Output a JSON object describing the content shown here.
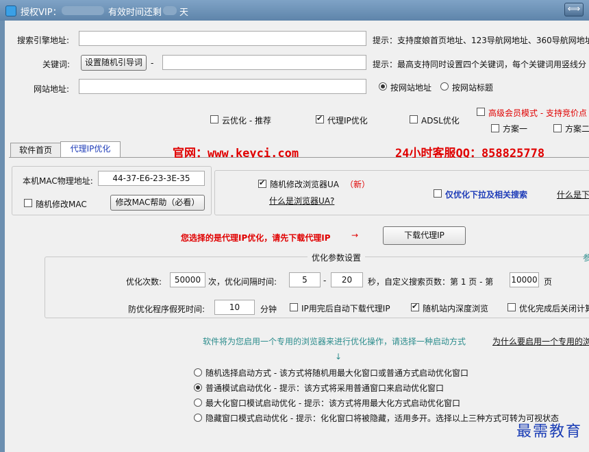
{
  "titlebar": {
    "prefix": "授权VIP：",
    "mid": "有效时间还剩",
    "suffix": "天",
    "restore_icon": "⟺"
  },
  "top": {
    "engine_label": "搜索引擎地址:",
    "engine_value": "",
    "engine_hint": "提示：支持度娘首页地址、123导航网地址、360导航网地址",
    "keyword_label": "关键词:",
    "random_guide_button": "设置随机引导词",
    "dash": "-",
    "keyword_value": "",
    "keyword_hint": "提示：最高支持同时设置四个关键词，每个关键词用竖线分",
    "site_label": "网站地址:",
    "site_value": "",
    "radio_by_url": "按网站地址",
    "radio_by_title": "按网站标题",
    "cloud_opt": "云优化 - 推荐",
    "proxy_opt": "代理IP优化",
    "adsl_opt": "ADSL优化",
    "senior_mode": "高级会员模式 - 支持竞价点",
    "plan1": "方案一",
    "plan2": "方案二"
  },
  "tabs": {
    "home": "软件首页",
    "proxy": "代理IP优化",
    "website": "官网：www.keyci.com",
    "service": "24小时客服QQ：858825778"
  },
  "mac": {
    "label": "本机MAC物理地址:",
    "value": "44-37-E6-23-3E-35",
    "random_mac": "随机修改MAC",
    "help_button": "修改MAC帮助（必看）",
    "random_ua": "随机修改浏览器UA",
    "new_badge": "（新）",
    "what_is_ua": "什么是浏览器UA?",
    "only_dropdown": "仅优化下拉及相关搜索",
    "what_is_dropdown": "什么是下"
  },
  "proxy": {
    "notice": "您选择的是代理IP优化，请先下载代理IP",
    "arrow": "→",
    "download_button": "下载代理IP"
  },
  "params": {
    "group_title": "优化参数设置",
    "more": "参",
    "count_label": "优化次数:",
    "count_value": "50000",
    "times_interval": "次，优化间隔时间:",
    "interval_min": "5",
    "dash": "-",
    "interval_max": "20",
    "seconds_pages": "秒，自定义搜索页数：第 1 页 - 第",
    "page_max": "10000",
    "page_unit": "页",
    "freeze_label": "防优化程序假死时间:",
    "freeze_value": "10",
    "minutes": "分钟",
    "auto_download": "IP用完后自动下载代理IP",
    "deep_browse": "随机站内深度浏览",
    "close_after": "优化完成后关闭计算"
  },
  "browser": {
    "intro": "软件将为您启用一个专用的浏览器来进行优化操作，请选择一种启动方式",
    "why_link": "为什么要启用一个专用的浏",
    "down_arrow": "↓",
    "opt1": "随机选择启动方式 - 该方式将随机用最大化窗口或普通方式启动优化窗口",
    "opt2": "普通模试启动优化 - 提示：该方式将采用普通窗口来启动优化窗口",
    "opt3": "最大化窗口模试启动优化 - 提示：该方式将用最大化方式启动优化窗口",
    "opt4": "隐藏窗口模式启动优化 - 提示：化化窗口将被隐藏，适用多开。选择以上三种方式可转为可视状态"
  },
  "watermark": "最需教育"
}
